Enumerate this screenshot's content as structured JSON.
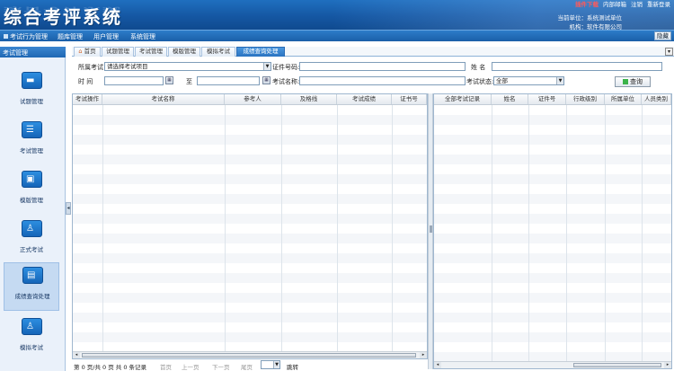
{
  "header": {
    "title": "综合考评系统",
    "top_links": [
      "插件下载",
      "内部邮箱",
      "注销",
      "重新登录"
    ],
    "unit_label": "当前单位：系统测试单位",
    "org_label": "机构：软件有限公司"
  },
  "menu": {
    "items": [
      "考试行为管理",
      "题库管理",
      "用户管理",
      "系统管理"
    ],
    "return_label": "隐藏"
  },
  "sidebar": {
    "header": "考试管理",
    "items": [
      {
        "label": "试题管理",
        "icon": "book-icon"
      },
      {
        "label": "考试管理",
        "icon": "list-icon"
      },
      {
        "label": "模版管理",
        "icon": "template-icon"
      },
      {
        "label": "正式考试",
        "icon": "exam-icon"
      },
      {
        "label": "成绩查询处理",
        "icon": "score-icon"
      },
      {
        "label": "模拟考试",
        "icon": "practice-icon"
      }
    ],
    "active_index": 4
  },
  "tabs": [
    {
      "label": "首页",
      "icon": "home-icon"
    },
    {
      "label": "试题管理"
    },
    {
      "label": "考试管理"
    },
    {
      "label": "模版管理"
    },
    {
      "label": "模拟考试"
    },
    {
      "label": "成绩查询处理"
    }
  ],
  "active_tab": 5,
  "form": {
    "exam_label": "所属考试",
    "exam_value": "请选择考试项目",
    "cert_label": "证件号码:",
    "cert_value": "",
    "name_label": "姓 名",
    "name_value": "",
    "time_label": "时 间",
    "time_from": "",
    "to_label": "至",
    "time_to": "",
    "exam_name_label": "考试名称:",
    "exam_name_value": "",
    "status_label": "考试状态:",
    "status_value": "全部",
    "query_label": "查询"
  },
  "left_grid": {
    "columns": [
      "考试操作",
      "考试名称",
      "参考人",
      "及格线",
      "考试成绩",
      "证书号"
    ]
  },
  "right_grid": {
    "columns": [
      "全部考试记录",
      "姓名",
      "证件号",
      "行政级别",
      "所属单位",
      "人员类别"
    ]
  },
  "pager": {
    "info": "第 0 页/共 0 页  共 0 条记录",
    "first": "首页",
    "prev": "上一页",
    "next": "下一页",
    "last": "尾页",
    "page_value": "",
    "goto": "跳转"
  }
}
